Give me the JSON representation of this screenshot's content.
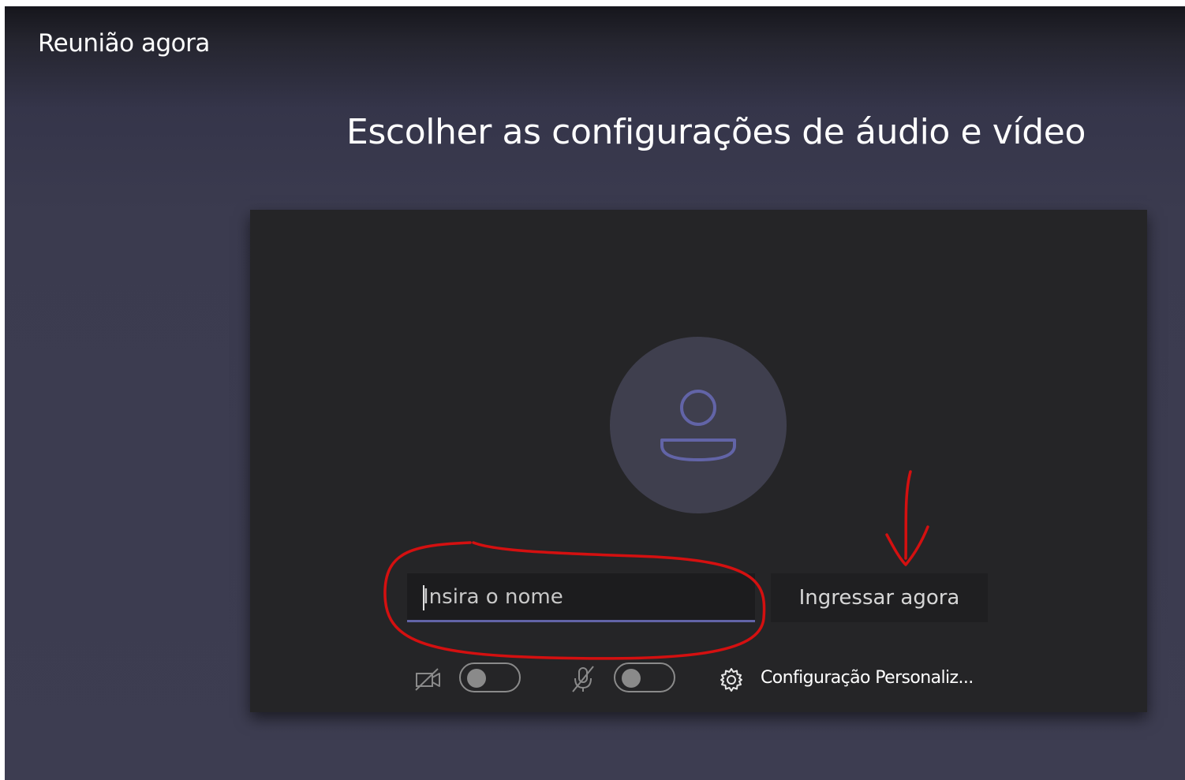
{
  "window": {
    "title": "Reunião agora"
  },
  "main": {
    "heading": "Escolher as configurações de áudio e vídeo"
  },
  "preview": {
    "avatar_icon": "person-icon"
  },
  "join_form": {
    "name_placeholder": "Insira o nome",
    "name_value": "",
    "join_label": "Ingressar agora"
  },
  "controls": {
    "camera": {
      "icon": "camera-off-icon",
      "on": false
    },
    "microphone": {
      "icon": "mic-off-icon",
      "on": false
    },
    "device_settings": {
      "icon": "gear-icon",
      "label": "Configuração Personaliz..."
    }
  },
  "colors": {
    "accent": "#6264a7",
    "annotation": "#d41010",
    "panel": "#252527",
    "background": "#3d3d51"
  }
}
